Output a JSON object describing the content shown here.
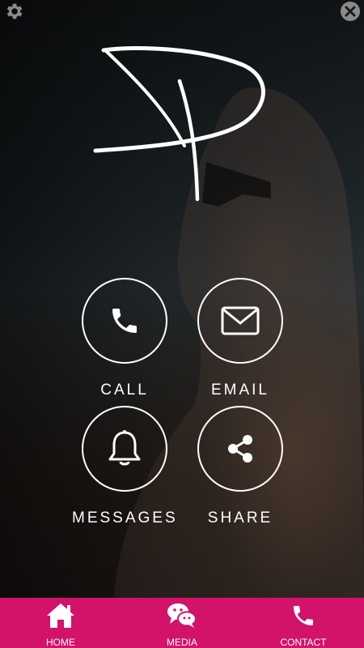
{
  "actions": [
    {
      "label": "CALL",
      "icon": "phone-icon"
    },
    {
      "label": "EMAIL",
      "icon": "envelope-icon"
    },
    {
      "label": "MESSAGES",
      "icon": "bell-icon"
    },
    {
      "label": "SHARE",
      "icon": "share-icon"
    }
  ],
  "tabs": [
    {
      "label": "HOME",
      "icon": "home-icon"
    },
    {
      "label": "MEDIA",
      "icon": "chat-bubbles-icon"
    },
    {
      "label": "CONTACT",
      "icon": "phone-icon"
    }
  ],
  "colors": {
    "tabbar": "#d3126a",
    "foreground": "#ffffff"
  }
}
